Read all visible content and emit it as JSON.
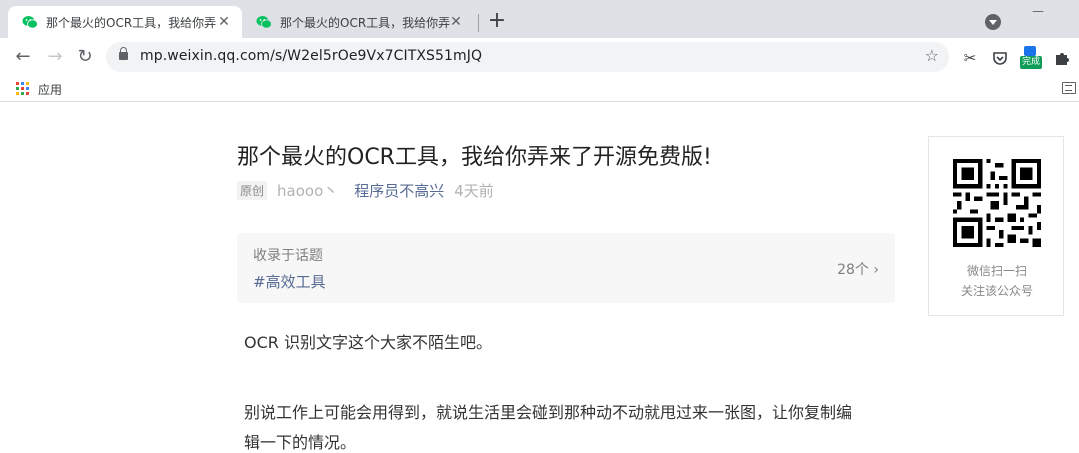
{
  "tabs": [
    {
      "title": "那个最火的OCR工具，我给你弄来了开源免费版！",
      "active": true
    },
    {
      "title": "那个最火的OCR工具，我给你弄来了开源免费版！",
      "active": false
    }
  ],
  "toolbar": {
    "url": "mp.weixin.qq.com/s/W2el5rOe9Vx7CITXS51mJQ",
    "extension_badge": "完成"
  },
  "bookmarks": {
    "apps_label": "应用"
  },
  "article": {
    "title": "那个最火的OCR工具，我给你弄来了开源免费版!",
    "original_badge": "原创",
    "author": "haooo丶",
    "account": "程序员不高兴",
    "time": "4天前",
    "topic": {
      "label": "收录于话题",
      "tag": "#高效工具",
      "count": "28个 ›"
    },
    "paragraphs": [
      "OCR 识别文字这个大家不陌生吧。",
      "别说工作上可能会用得到，就说生活里会碰到那种动不动就甩过来一张图，让你复制编",
      "辑一下的情况。"
    ]
  },
  "qr": {
    "caption_line1": "微信扫一扫",
    "caption_line2": "关注该公众号"
  },
  "colors": {
    "link": "#576b95",
    "wechat_green": "#07c160",
    "tabstrip": "#dee1e6"
  },
  "icons": [
    "wechat-icon",
    "close-icon",
    "plus-icon",
    "tab-search-icon",
    "back-icon",
    "forward-icon",
    "reload-icon",
    "lock-icon",
    "star-icon",
    "scissors-icon",
    "pocket-icon",
    "puzzle-icon",
    "apps-grid-icon",
    "reading-list-icon",
    "qr-code-icon"
  ]
}
